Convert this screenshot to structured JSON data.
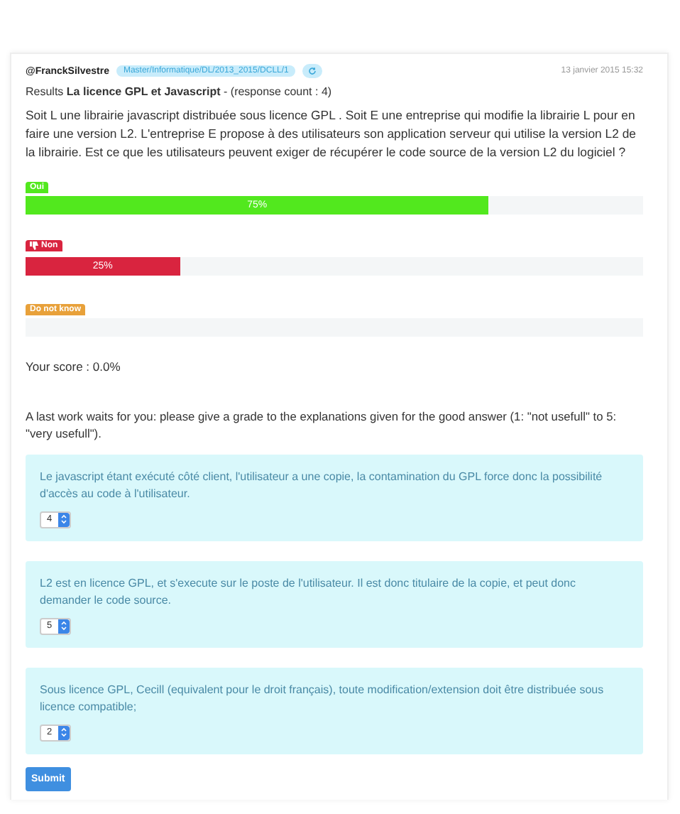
{
  "header": {
    "author": "@FranckSilvestre",
    "tag": "Master/Informatique/DL/2013_2015/DCLL/1",
    "date": "13 janvier 2015 15:32"
  },
  "results": {
    "prefix": "Results",
    "title": "La licence GPL et Javascript",
    "suffix": "- (response count : 4)"
  },
  "question": "Soit L une librairie javascript distribuée sous licence GPL . Soit E une entreprise qui modifie la librairie L pour en faire une version L2. L'entreprise E propose à des utilisateurs son application serveur qui utilise la version L2 de la librairie. Est ce que les utilisateurs peuvent exiger de récupérer le code source de la version L2 du logiciel ?",
  "answers": [
    {
      "label": "Oui",
      "kind": "plain",
      "color": "#52e81e",
      "level": 0.75,
      "reading": "75%"
    },
    {
      "label": "Non",
      "kind": "thumbs-down",
      "color": "#d9243f",
      "level": 0.25,
      "reading": "25%"
    },
    {
      "label": "Do not know",
      "kind": "plain",
      "color": "#e8a13a",
      "level": 0
    }
  ],
  "score": "Your score : 0.0%",
  "instructions": "A last work waits for you: please give a grade to the explanations given for the good answer (1: \"not usefull\" to 5: \"very usefull\").",
  "explanations": [
    {
      "text": "Le javascript étant exécuté côté client, l'utilisateur a une copie, la contamination du GPL force donc la possibilité d'accès au code à l'utilisateur.",
      "grade": "4"
    },
    {
      "text": "L2 est en licence GPL, et s'execute sur le poste de l'utilisateur. Il est donc titulaire de la copie, et peut donc demander le code source.",
      "grade": "5"
    },
    {
      "text": "Sous licence GPL, Cecill (equivalent pour le droit français), toute modification/extension doit être distribuée sous licence compatible;",
      "grade": "2"
    }
  ],
  "submit": "Submit"
}
